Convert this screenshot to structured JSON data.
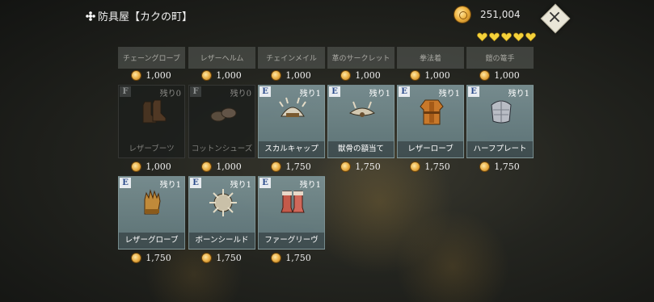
{
  "header": {
    "title": "防具屋【カクの町】",
    "money": "251,004",
    "hearts": 5,
    "close_label": "×"
  },
  "colors": {
    "accent_gold": "#f0b441",
    "card_available": "#7c9396",
    "card_sold": "#1c1e1c",
    "heart": "#f5d23a"
  },
  "sold_out_row": [
    {
      "name": "チェーングローブ",
      "price": "1,000"
    },
    {
      "name": "レザーヘルム",
      "price": "1,000"
    },
    {
      "name": "チェインメイル",
      "price": "1,000"
    },
    {
      "name": "革のサークレット",
      "price": "1,000"
    },
    {
      "name": "拳法着",
      "price": "1,000"
    },
    {
      "name": "鎧の篭手",
      "price": "1,000"
    }
  ],
  "items": [
    {
      "grade": "F",
      "stock": "残り0",
      "name": "レザーブーツ",
      "price": "1,000",
      "icon": "leather-boots-icon",
      "available": false
    },
    {
      "grade": "F",
      "stock": "残り0",
      "name": "コットンシューズ",
      "price": "1,000",
      "icon": "cotton-shoes-icon",
      "available": false
    },
    {
      "grade": "E",
      "stock": "残り1",
      "name": "スカルキャップ",
      "price": "1,750",
      "icon": "skull-cap-icon",
      "available": true
    },
    {
      "grade": "E",
      "stock": "残り1",
      "name": "獣骨の額当て",
      "price": "1,750",
      "icon": "bone-headband-icon",
      "available": true
    },
    {
      "grade": "E",
      "stock": "残り1",
      "name": "レザーローブ",
      "price": "1,750",
      "icon": "leather-robe-icon",
      "available": true
    },
    {
      "grade": "E",
      "stock": "残り1",
      "name": "ハーフプレート",
      "price": "1,750",
      "icon": "half-plate-icon",
      "available": true
    },
    {
      "grade": "E",
      "stock": "残り1",
      "name": "レザーグローブ",
      "price": "1,750",
      "icon": "leather-gloves-icon",
      "available": true
    },
    {
      "grade": "E",
      "stock": "残り1",
      "name": "ボーンシールド",
      "price": "1,750",
      "icon": "bone-shield-icon",
      "available": true
    },
    {
      "grade": "E",
      "stock": "残り1",
      "name": "ファーグリーヴ",
      "price": "1,750",
      "icon": "fur-greaves-icon",
      "available": true
    }
  ]
}
